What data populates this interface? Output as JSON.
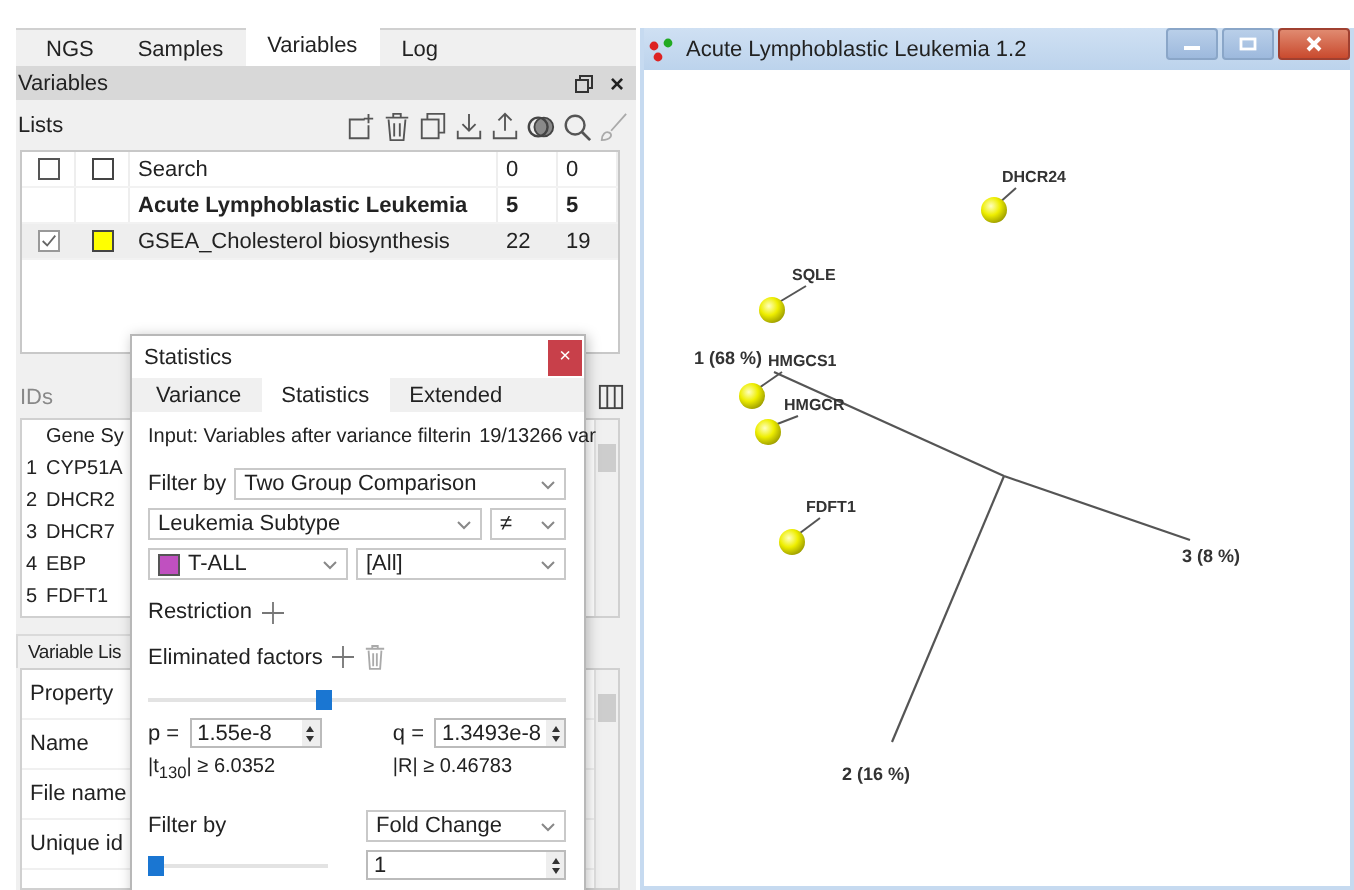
{
  "tabs": [
    {
      "label": "NGS",
      "selected": false
    },
    {
      "label": "Samples",
      "selected": false
    },
    {
      "label": "Variables",
      "selected": true
    },
    {
      "label": "Log",
      "selected": false
    }
  ],
  "variables_panel": {
    "title": "Variables",
    "close": "×",
    "lists_label": "Lists",
    "lists": [
      {
        "kind": "search",
        "checked": false,
        "color": "#ffffff",
        "name": "Search",
        "count_1": "0",
        "count_2": "0",
        "selected": false
      },
      {
        "kind": "group",
        "name": "Acute Lymphoblastic Leukemia",
        "count_1": "5",
        "count_2": "5",
        "selected": false
      },
      {
        "kind": "list",
        "checked": true,
        "color": "#ffff00",
        "name": "GSEA_Cholesterol biosynthesis",
        "count_1": "22",
        "count_2": "19",
        "selected": true
      }
    ]
  },
  "ids_panel": {
    "title": "IDs",
    "column": "Gene Sy",
    "rows": [
      {
        "index": "1",
        "gene": "CYP51A"
      },
      {
        "index": "2",
        "gene": "DHCR2"
      },
      {
        "index": "3",
        "gene": "DHCR7"
      },
      {
        "index": "4",
        "gene": "EBP"
      },
      {
        "index": "5",
        "gene": "FDFT1"
      }
    ]
  },
  "variable_list_panel": {
    "tab": "Variable Lis",
    "header": "Property",
    "rows": [
      "Name",
      "File name",
      "Unique id"
    ]
  },
  "statistics_dialog": {
    "title": "Statistics",
    "close": "×",
    "tabs": [
      {
        "label": "Variance",
        "selected": false
      },
      {
        "label": "Statistics",
        "selected": true
      },
      {
        "label": "Extended",
        "selected": false
      }
    ],
    "input_label": "Input: Variables after variance filterin",
    "input_count": "19/13266 var",
    "filter_label": "Filter by",
    "filter_mode": "Two Group Comparison",
    "factor": "Leukemia Subtype",
    "operator": "≠",
    "group_a": {
      "label": "T-ALL",
      "color": "#c050c0"
    },
    "group_b": "[All]",
    "restriction_label": "Restriction",
    "eliminated_label": "Eliminated factors",
    "p_slider": {
      "level": 0.42
    },
    "p_label": "p =",
    "p_value": "1.55e-8",
    "q_label": "q =",
    "q_value": "1.3493e-8",
    "t_threshold": "|t$_{130}$| ≥ 6.0352",
    "r_threshold": "|R| ≥ 0.46783",
    "filter2_label": "Filter by",
    "filter2_mode": "Fold Change",
    "fc_slider": {
      "level": 0
    },
    "fc_value": "1"
  },
  "plot_window": {
    "title": "Acute Lymphoblastic Leukemia 1.2",
    "points": [
      "DHCR24",
      "SQLE",
      "HMGCS1",
      "HMGCR",
      "FDFT1"
    ],
    "axes": [
      "1 (68 %)",
      "2 (16 %)",
      "3 (8 %)"
    ]
  }
}
